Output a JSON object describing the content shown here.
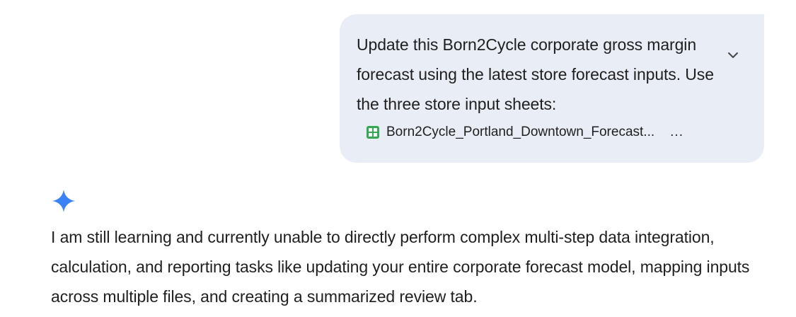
{
  "user_message": {
    "text": "Update this Born2Cycle corporate gross margin forecast using the latest store forecast inputs. Use the three store input sheets:",
    "attachment": {
      "icon": "sheets-icon",
      "name": "Born2Cycle_Portland_Downtown_Forecast..."
    },
    "more_label": "...",
    "expand_icon": "chevron-down-icon"
  },
  "assistant_message": {
    "icon": "gemini-sparkle-icon",
    "text": "I am still learning and currently unable to directly perform complex multi-step data integration, calculation, and reporting tasks like updating your entire corporate forecast model, mapping inputs across multiple files, and creating a summarized review tab."
  },
  "colors": {
    "bubble_bg": "#e9eef6",
    "sheets_green": "#34a853",
    "sparkle_blue": "#3b82f6"
  }
}
